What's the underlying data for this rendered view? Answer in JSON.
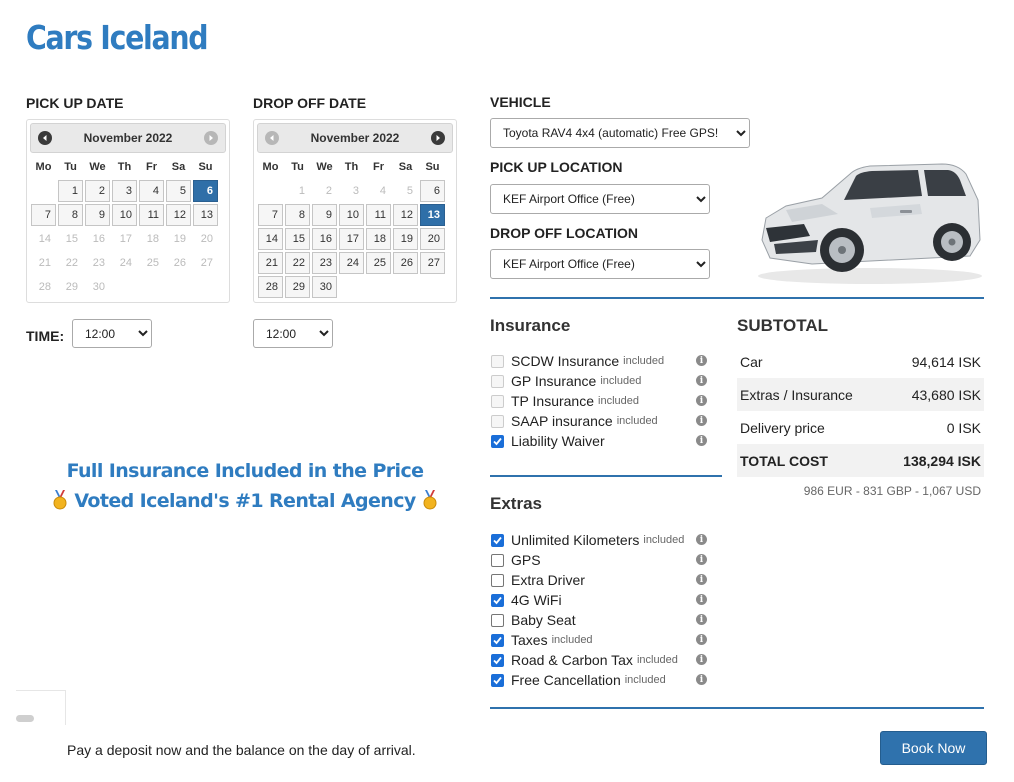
{
  "brand": "Cars Iceland",
  "pickup": {
    "label": "PICK UP DATE",
    "month": "November 2022",
    "time_label": "TIME:",
    "time_value": "12:00",
    "days": [
      {
        "d": "",
        "s": "empty"
      },
      {
        "d": "1",
        "s": "av"
      },
      {
        "d": "2",
        "s": "av"
      },
      {
        "d": "3",
        "s": "av"
      },
      {
        "d": "4",
        "s": "av"
      },
      {
        "d": "5",
        "s": "av"
      },
      {
        "d": "6",
        "s": "sel"
      },
      {
        "d": "7",
        "s": "av"
      },
      {
        "d": "8",
        "s": "av"
      },
      {
        "d": "9",
        "s": "av"
      },
      {
        "d": "10",
        "s": "av"
      },
      {
        "d": "11",
        "s": "av"
      },
      {
        "d": "12",
        "s": "av"
      },
      {
        "d": "13",
        "s": "av"
      },
      {
        "d": "14",
        "s": "dis"
      },
      {
        "d": "15",
        "s": "dis"
      },
      {
        "d": "16",
        "s": "dis"
      },
      {
        "d": "17",
        "s": "dis"
      },
      {
        "d": "18",
        "s": "dis"
      },
      {
        "d": "19",
        "s": "dis"
      },
      {
        "d": "20",
        "s": "dis"
      },
      {
        "d": "21",
        "s": "dis"
      },
      {
        "d": "22",
        "s": "dis"
      },
      {
        "d": "23",
        "s": "dis"
      },
      {
        "d": "24",
        "s": "dis"
      },
      {
        "d": "25",
        "s": "dis"
      },
      {
        "d": "26",
        "s": "dis"
      },
      {
        "d": "27",
        "s": "dis"
      },
      {
        "d": "28",
        "s": "dis"
      },
      {
        "d": "29",
        "s": "dis"
      },
      {
        "d": "30",
        "s": "dis"
      }
    ]
  },
  "dropoff": {
    "label": "DROP OFF DATE",
    "month": "November 2022",
    "time_value": "12:00",
    "days": [
      {
        "d": "",
        "s": "empty"
      },
      {
        "d": "1",
        "s": "dis"
      },
      {
        "d": "2",
        "s": "dis"
      },
      {
        "d": "3",
        "s": "dis"
      },
      {
        "d": "4",
        "s": "dis"
      },
      {
        "d": "5",
        "s": "dis"
      },
      {
        "d": "6",
        "s": "av"
      },
      {
        "d": "7",
        "s": "av"
      },
      {
        "d": "8",
        "s": "av"
      },
      {
        "d": "9",
        "s": "av"
      },
      {
        "d": "10",
        "s": "av"
      },
      {
        "d": "11",
        "s": "av"
      },
      {
        "d": "12",
        "s": "av"
      },
      {
        "d": "13",
        "s": "sel"
      },
      {
        "d": "14",
        "s": "av"
      },
      {
        "d": "15",
        "s": "av"
      },
      {
        "d": "16",
        "s": "av"
      },
      {
        "d": "17",
        "s": "av"
      },
      {
        "d": "18",
        "s": "av"
      },
      {
        "d": "19",
        "s": "av"
      },
      {
        "d": "20",
        "s": "av"
      },
      {
        "d": "21",
        "s": "av"
      },
      {
        "d": "22",
        "s": "av"
      },
      {
        "d": "23",
        "s": "av"
      },
      {
        "d": "24",
        "s": "av"
      },
      {
        "d": "25",
        "s": "av"
      },
      {
        "d": "26",
        "s": "av"
      },
      {
        "d": "27",
        "s": "av"
      },
      {
        "d": "28",
        "s": "av"
      },
      {
        "d": "29",
        "s": "av"
      },
      {
        "d": "30",
        "s": "av"
      }
    ]
  },
  "weekdays": [
    "Mo",
    "Tu",
    "We",
    "Th",
    "Fr",
    "Sa",
    "Su"
  ],
  "vehicle": {
    "label": "VEHICLE",
    "value": "Toyota RAV4 4x4 (automatic) Free GPS!"
  },
  "pickup_location": {
    "label": "PICK UP LOCATION",
    "value": "KEF Airport Office (Free)"
  },
  "dropoff_location": {
    "label": "DROP OFF LOCATION",
    "value": "KEF Airport Office (Free)"
  },
  "insurance": {
    "title": "Insurance",
    "items": [
      {
        "label": "SCDW Insurance",
        "note": "included",
        "checked": true,
        "disabled": true
      },
      {
        "label": "GP Insurance",
        "note": "included",
        "checked": true,
        "disabled": true
      },
      {
        "label": "TP Insurance",
        "note": "included",
        "checked": true,
        "disabled": true
      },
      {
        "label": "SAAP insurance",
        "note": "included",
        "checked": true,
        "disabled": true
      },
      {
        "label": "Liability Waiver",
        "note": "",
        "checked": true,
        "disabled": false
      }
    ]
  },
  "extras": {
    "title": "Extras",
    "items": [
      {
        "label": "Unlimited Kilometers",
        "note": "included",
        "checked": true
      },
      {
        "label": "GPS",
        "note": "",
        "checked": false
      },
      {
        "label": "Extra Driver",
        "note": "",
        "checked": false
      },
      {
        "label": "4G WiFi",
        "note": "",
        "checked": true
      },
      {
        "label": "Baby Seat",
        "note": "",
        "checked": false
      },
      {
        "label": "Taxes",
        "note": "included",
        "checked": true
      },
      {
        "label": "Road & Carbon Tax",
        "note": "included",
        "checked": true
      },
      {
        "label": "Free Cancellation",
        "note": "included",
        "checked": true
      }
    ]
  },
  "subtotal": {
    "title": "SUBTOTAL",
    "rows": [
      {
        "label": "Car",
        "value": "94,614 ISK"
      },
      {
        "label": "Extras / Insurance",
        "value": "43,680 ISK"
      },
      {
        "label": "Delivery price",
        "value": "0 ISK"
      },
      {
        "label": "TOTAL COST",
        "value": "138,294 ISK"
      }
    ],
    "currencies": "986 EUR - 831 GBP - 1,067 USD"
  },
  "promo": {
    "line1": "Full Insurance Included in the Price",
    "line2": "Voted Iceland's #1 Rental Agency"
  },
  "deposit_text": "Pay a deposit now and the balance on the day of arrival.",
  "book_button": "Book Now",
  "info_glyph": "i",
  "colors": {
    "brand": "#2f7cc0",
    "accent": "#2f72ad",
    "selected_day": "#2f6fa8",
    "checkbox": "#1a6ed8"
  }
}
